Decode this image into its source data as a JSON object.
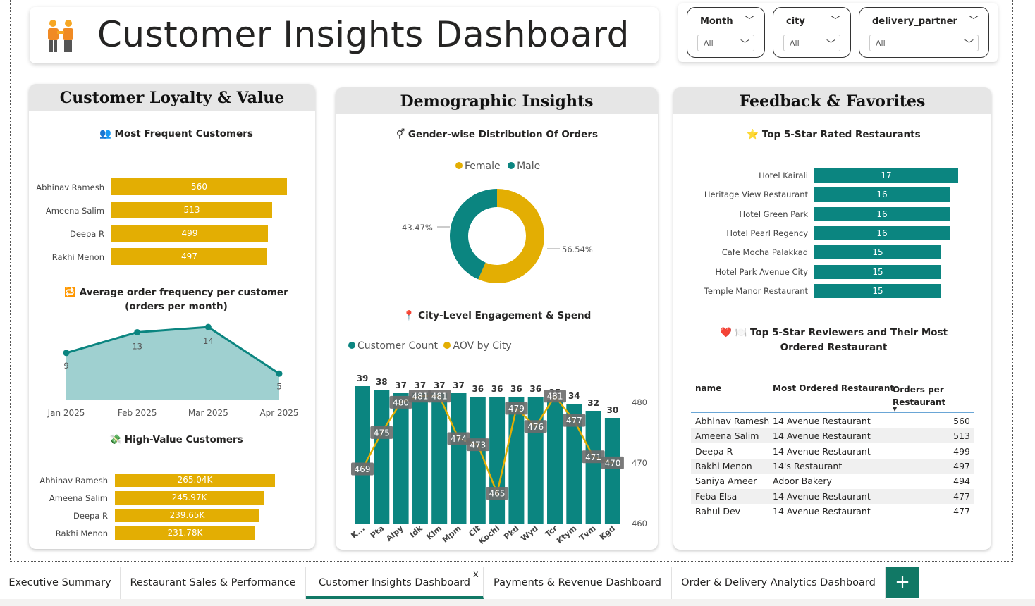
{
  "title": "Customer Insights Dashboard",
  "slicers": [
    {
      "label": "Month",
      "value": "All"
    },
    {
      "label": "city",
      "value": "All"
    },
    {
      "label": "delivery_partner",
      "value": "All"
    }
  ],
  "loyalty": {
    "heading": "Customer Loyalty & Value",
    "frequent_title": "👥 Most Frequent Customers",
    "frequent": [
      {
        "name": "Abhinav Ramesh",
        "value": "560"
      },
      {
        "name": "Ameena Salim",
        "value": "513"
      },
      {
        "name": "Deepa R",
        "value": "499"
      },
      {
        "name": "Rakhi Menon",
        "value": "497"
      }
    ],
    "freq_chart_title": "🔁 Average order frequency per customer (orders per month)",
    "high_value_title": "💸 High-Value Customers",
    "high_value": [
      {
        "name": "Abhinav Ramesh",
        "value": "265.04K"
      },
      {
        "name": "Ameena Salim",
        "value": "245.97K"
      },
      {
        "name": "Deepa R",
        "value": "239.65K"
      },
      {
        "name": "Rakhi Menon",
        "value": "231.78K"
      }
    ]
  },
  "demographic": {
    "heading": "Demographic Insights",
    "gender_title": "⚥ Gender-wise Distribution Of Orders",
    "legend_female": "Female",
    "legend_male": "Male",
    "male_pct_label": "43.47%",
    "female_pct_label": "56.54%",
    "city_title": "📍 City-Level Engagement & Spend",
    "legend_count": "Customer Count",
    "legend_aov": "AOV by City"
  },
  "feedback": {
    "heading": "Feedback & Favorites",
    "top_title": "⭐ Top  5-Star Rated Restaurants",
    "top_restaurants": [
      {
        "name": "Hotel Kairali",
        "value": "17"
      },
      {
        "name": "Heritage View Restaurant",
        "value": "16"
      },
      {
        "name": "Hotel Green Park",
        "value": "16"
      },
      {
        "name": "Hotel Pearl Regency",
        "value": "16"
      },
      {
        "name": "Cafe Mocha Palakkad",
        "value": "15"
      },
      {
        "name": "Hotel Park Avenue City",
        "value": "15"
      },
      {
        "name": "Temple Manor Restaurant",
        "value": "15"
      }
    ],
    "reviewers_title": "❤️ 🍽️ Top 5-Star Reviewers and Their Most Ordered Restaurant",
    "table_headers": {
      "name": "name",
      "restaurant": "Most Ordered Restaurant",
      "orders": "Orders per Restaurant"
    },
    "table_rows": [
      {
        "name": "Abhinav Ramesh",
        "restaurant": "14 Avenue Restaurant",
        "orders": "560"
      },
      {
        "name": "Ameena Salim",
        "restaurant": "14 Avenue Restaurant",
        "orders": "513"
      },
      {
        "name": "Deepa R",
        "restaurant": "14 Avenue Restaurant",
        "orders": "499"
      },
      {
        "name": "Rakhi Menon",
        "restaurant": "14's Restaurant",
        "orders": "497"
      },
      {
        "name": "Saniya Ameer",
        "restaurant": "Adoor Bakery",
        "orders": "494"
      },
      {
        "name": "Feba Elsa",
        "restaurant": "14 Avenue Restaurant",
        "orders": "477"
      },
      {
        "name": "Rahul Dev",
        "restaurant": "14 Avenue Restaurant",
        "orders": "477"
      }
    ]
  },
  "tabs": [
    {
      "label": "Executive Summary"
    },
    {
      "label": "Restaurant Sales & Performance"
    },
    {
      "label": "Customer Insights Dashboard"
    },
    {
      "label": "Payments & Revenue Dashboard"
    },
    {
      "label": "Order & Delivery Analytics Dashboard"
    }
  ],
  "add_tab_label": "+",
  "close_tab_label": "x",
  "colors": {
    "gold": "#e3ae03",
    "teal": "#0b8580",
    "area": "#9fd0d0",
    "active_tab": "#117865"
  },
  "chart_data": [
    {
      "type": "bar",
      "title": "Most Frequent Customers",
      "categories": [
        "Abhinav Ramesh",
        "Ameena Salim",
        "Deepa R",
        "Rakhi Menon"
      ],
      "values": [
        560,
        513,
        499,
        497
      ]
    },
    {
      "type": "area",
      "title": "Average order frequency per customer (orders per month)",
      "categories": [
        "Jan 2025",
        "Feb 2025",
        "Mar 2025",
        "Apr 2025"
      ],
      "values": [
        9,
        13,
        14,
        5
      ]
    },
    {
      "type": "bar",
      "title": "High-Value Customers",
      "categories": [
        "Abhinav Ramesh",
        "Ameena Salim",
        "Deepa R",
        "Rakhi Menon"
      ],
      "values": [
        265040,
        245970,
        239650,
        231780
      ]
    },
    {
      "type": "pie",
      "title": "Gender-wise Distribution Of Orders",
      "categories": [
        "Female",
        "Male"
      ],
      "values": [
        56.54,
        43.47
      ]
    },
    {
      "type": "bar",
      "title": "City-Level Engagement & Spend",
      "categories": [
        "K...",
        "Pta",
        "Alpy",
        "Idk",
        "Klm",
        "Mpm",
        "Clt",
        "Kochi",
        "Pkd",
        "Wyd",
        "Tcr",
        "Ktym",
        "Tvm",
        "Kgd"
      ],
      "series": [
        {
          "name": "Customer Count",
          "values": [
            39,
            38,
            37,
            37,
            37,
            37,
            36,
            36,
            36,
            36,
            35,
            34,
            32,
            30
          ]
        },
        {
          "name": "AOV by City",
          "values": [
            469,
            475,
            480,
            481,
            481,
            474,
            473,
            465,
            479,
            476,
            481,
            477,
            471,
            470
          ]
        }
      ],
      "y2_ticks": [
        460,
        470,
        480
      ]
    },
    {
      "type": "bar",
      "title": "Top 5-Star Rated Restaurants",
      "categories": [
        "Hotel Kairali",
        "Heritage View Restaurant",
        "Hotel Green Park",
        "Hotel Pearl Regency",
        "Cafe Mocha Palakkad",
        "Hotel Park Avenue City",
        "Temple Manor Restaurant"
      ],
      "values": [
        17,
        16,
        16,
        16,
        15,
        15,
        15
      ]
    }
  ]
}
